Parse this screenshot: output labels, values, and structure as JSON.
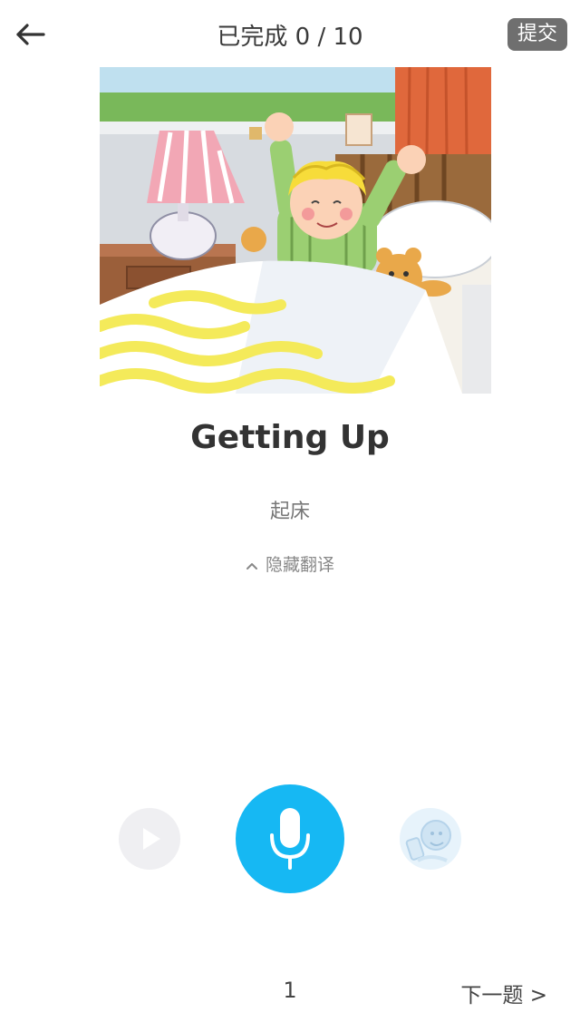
{
  "header": {
    "back_icon": "back-arrow-icon",
    "progress_text": "已完成 0 / 10",
    "submit_label": "提交"
  },
  "illustration": {
    "alt": "Getting Up illustration",
    "colors": {
      "curtain": "#e0683c",
      "lamp_shade": "#f2a7b5",
      "hair": "#f7dc3a",
      "pajamas": "#9bcf72",
      "bear": "#e9a84a",
      "blanket_stripe": "#f4ea5a"
    }
  },
  "word": {
    "english": "Getting Up",
    "chinese": "起床",
    "toggle_label": "隐藏翻译",
    "toggle_icon": "chevron-up-icon"
  },
  "controls": {
    "play_icon": "play-icon",
    "mic_icon": "microphone-icon",
    "record_icon": "my-recording-icon",
    "mic_color": "#16b8f3"
  },
  "footer": {
    "page_number": "1",
    "next_label": "下一题 >"
  }
}
